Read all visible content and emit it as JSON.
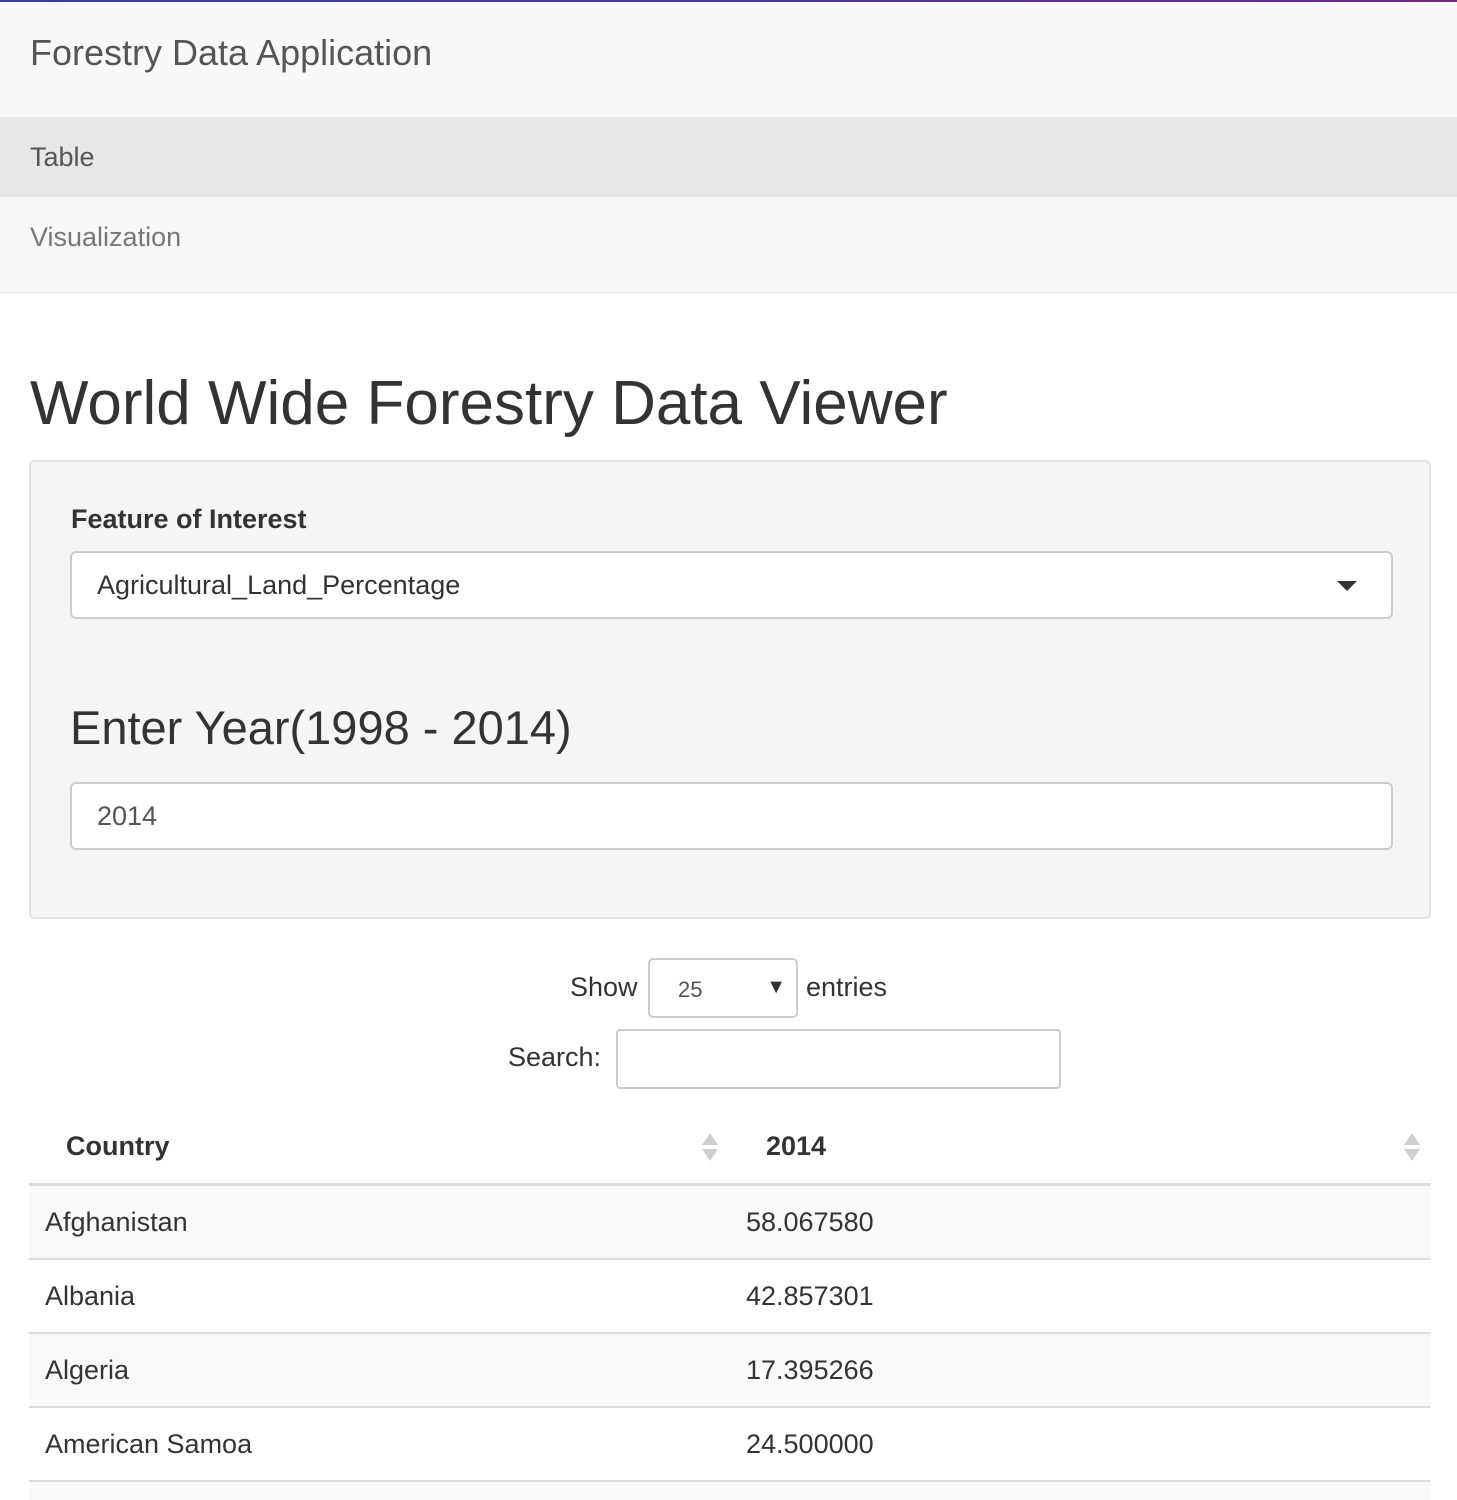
{
  "app": {
    "title": "Forestry Data Application"
  },
  "nav": {
    "items": [
      {
        "label": "Table"
      },
      {
        "label": "Visualization"
      }
    ]
  },
  "page": {
    "title": "World Wide Forestry Data Viewer"
  },
  "controls": {
    "feature_label": "Feature of Interest",
    "feature_value": "Agricultural_Land_Percentage",
    "year_label": "Enter Year(1998 - 2014)",
    "year_value": "2014"
  },
  "datatable": {
    "show_label": "Show",
    "length_value": "25",
    "entries_label": "entries",
    "search_label": "Search:",
    "search_value": "",
    "columns": [
      "Country",
      "2014"
    ],
    "rows": [
      {
        "country": "Afghanistan",
        "value": "58.067580"
      },
      {
        "country": "Albania",
        "value": "42.857301"
      },
      {
        "country": "Algeria",
        "value": "17.395266"
      },
      {
        "country": "American Samoa",
        "value": "24.500000"
      },
      {
        "country": "",
        "value": ""
      }
    ]
  },
  "colors": {
    "navbar_bg": "#f8f8f8",
    "active_nav_bg": "#e7e7e7",
    "well_bg": "#f5f5f5"
  }
}
